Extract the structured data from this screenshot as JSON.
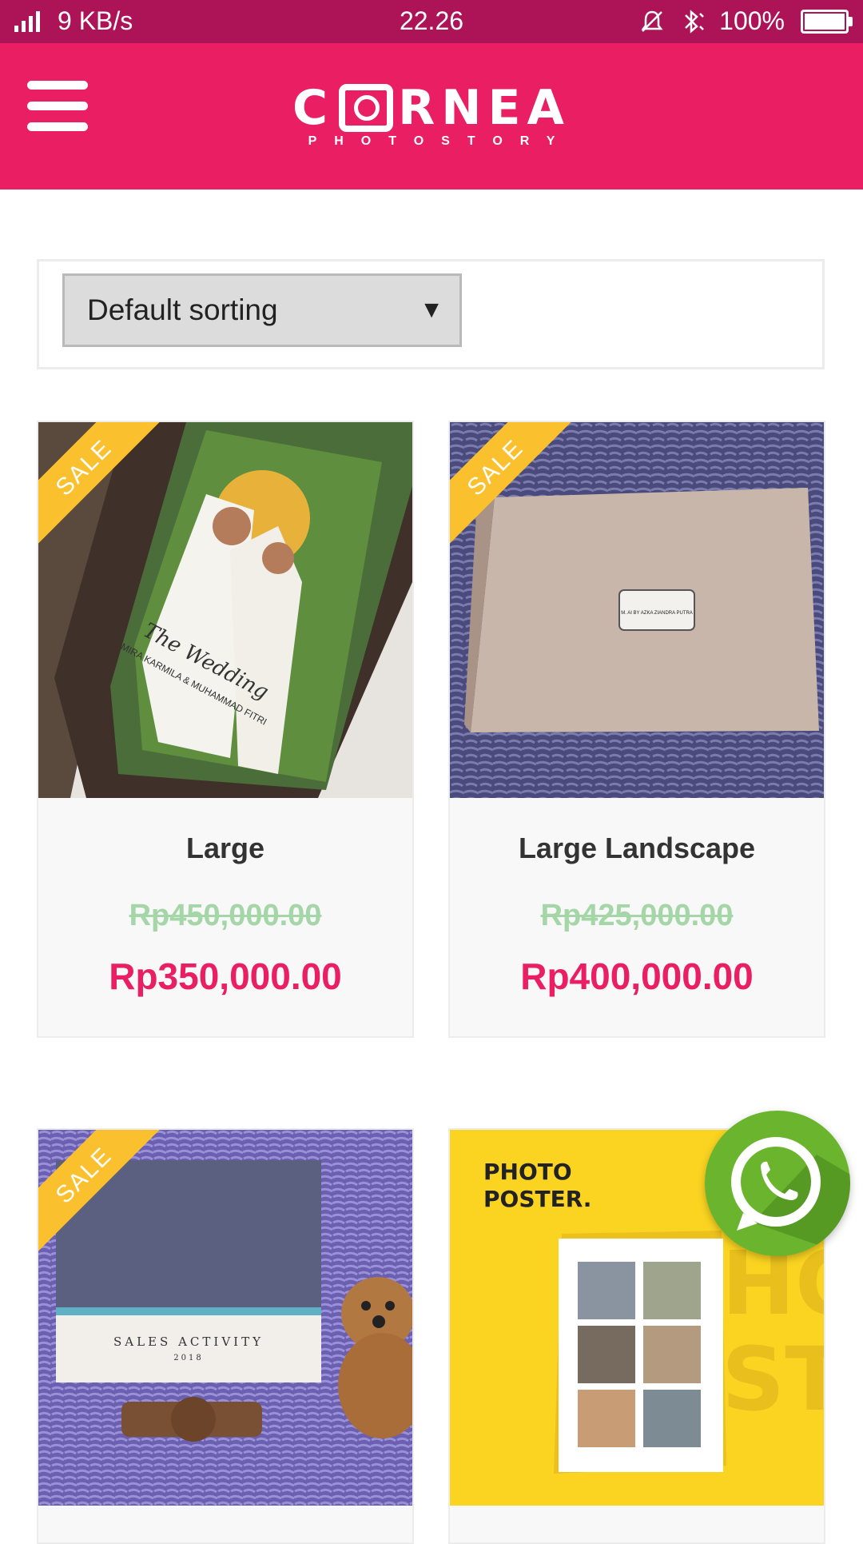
{
  "status_bar": {
    "network_speed": "9 KB/s",
    "time": "22.26",
    "battery": "100%",
    "battery_level": 1.0
  },
  "header": {
    "logo_text": "C RNEA",
    "logo_tagline": "PHOTOSTORY",
    "accent": "#e91e63",
    "statusbar_color": "#ad1457"
  },
  "sorting": {
    "selected": "Default sorting"
  },
  "products": [
    {
      "title": "Large",
      "old_price": "Rp450,000.00",
      "price": "Rp350,000.00",
      "badge": "SALE"
    },
    {
      "title": "Large Landscape",
      "old_price": "Rp425,000.00",
      "price": "Rp400,000.00",
      "badge": "SALE"
    },
    {
      "title": "",
      "old_price": "",
      "price": "",
      "badge": "SALE"
    },
    {
      "title": "",
      "old_price": "",
      "price": "",
      "badge": ""
    }
  ],
  "images": {
    "product3_caption": "SALES ACTIVITY",
    "product3_year": "2018",
    "product4_heading_line1": "PHOTO",
    "product4_heading_line2": "POSTER.",
    "product1_cover_title": "The Wedding",
    "product1_cover_names": "MIRA KARMILA & MUHAMMAD FITRI",
    "product2_plate": "M. AI BY AZKA ZIANDRA PUTRA"
  },
  "icons": {
    "menu": "hamburger-icon",
    "signal": "signal-icon",
    "mute": "bell-off-icon",
    "bluetooth": "bluetooth-icon",
    "battery": "battery-icon",
    "chat": "whatsapp-icon"
  }
}
